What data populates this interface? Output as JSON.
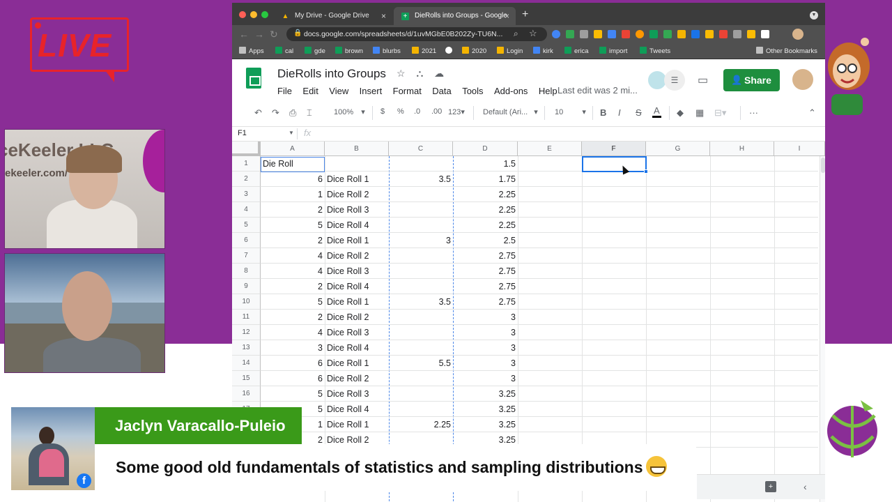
{
  "overlay": {
    "live_label": "LIVE",
    "presenter_name": "Jaclyn Varacallo-Puleio",
    "message": "Some good old fundamentals of statistics and sampling distributions",
    "cam1_sign": "ceKeeler LLC",
    "cam1_sign2": "ekeeler.com/",
    "social_icon": "facebook-icon"
  },
  "browser": {
    "tabs": [
      {
        "title": "My Drive - Google Drive",
        "icon": "google-drive-icon"
      },
      {
        "title": "DieRolls into Groups - Google",
        "icon": "google-sheets-icon"
      }
    ],
    "url": "docs.google.com/spreadsheets/d/1uvMGbE0B202Zy-TU6N...",
    "bookmarks": [
      "Apps",
      "cal",
      "gde",
      "brown",
      "blurbs",
      "2021",
      "2020",
      "Login",
      "kirk",
      "erica",
      "import",
      "Tweets"
    ],
    "other_bookmarks": "Other Bookmarks"
  },
  "sheet": {
    "title": "DieRolls into Groups",
    "menu": [
      "File",
      "Edit",
      "View",
      "Insert",
      "Format",
      "Data",
      "Tools",
      "Add-ons",
      "Help"
    ],
    "last_edit": "Last edit was 2 mi...",
    "share_label": "Share",
    "toolbar": {
      "zoom": "100%",
      "currency": "$",
      "percent": "%",
      "dec_decrease": ".0",
      "dec_increase": ".00",
      "more_formats": "123",
      "font": "Default (Ari...",
      "font_size": "10",
      "bold": "B",
      "italic": "I",
      "strike": "S",
      "text_color": "A"
    },
    "name_box": "F1",
    "fx_label": "fx",
    "columns": [
      "A",
      "B",
      "C",
      "D",
      "E",
      "F",
      "G",
      "H",
      "I"
    ],
    "selected_column": "F",
    "rows": [
      {
        "n": "1",
        "a": "Die Roll",
        "b": "",
        "c": "",
        "d": "1.5"
      },
      {
        "n": "2",
        "a": "6",
        "b": "Dice Roll 1",
        "c": "3.5",
        "d": "1.75"
      },
      {
        "n": "3",
        "a": "1",
        "b": "Dice Roll 2",
        "c": "",
        "d": "2.25"
      },
      {
        "n": "4",
        "a": "2",
        "b": "Dice Roll 3",
        "c": "",
        "d": "2.25"
      },
      {
        "n": "5",
        "a": "5",
        "b": "Dice Roll 4",
        "c": "",
        "d": "2.25"
      },
      {
        "n": "6",
        "a": "2",
        "b": "Dice Roll 1",
        "c": "3",
        "d": "2.5"
      },
      {
        "n": "7",
        "a": "4",
        "b": "Dice Roll 2",
        "c": "",
        "d": "2.75"
      },
      {
        "n": "8",
        "a": "4",
        "b": "Dice Roll 3",
        "c": "",
        "d": "2.75"
      },
      {
        "n": "9",
        "a": "2",
        "b": "Dice Roll 4",
        "c": "",
        "d": "2.75"
      },
      {
        "n": "10",
        "a": "5",
        "b": "Dice Roll 1",
        "c": "3.5",
        "d": "2.75"
      },
      {
        "n": "11",
        "a": "2",
        "b": "Dice Roll 2",
        "c": "",
        "d": "3"
      },
      {
        "n": "12",
        "a": "4",
        "b": "Dice Roll 3",
        "c": "",
        "d": "3"
      },
      {
        "n": "13",
        "a": "3",
        "b": "Dice Roll 4",
        "c": "",
        "d": "3"
      },
      {
        "n": "14",
        "a": "6",
        "b": "Dice Roll 1",
        "c": "5.5",
        "d": "3"
      },
      {
        "n": "15",
        "a": "6",
        "b": "Dice Roll 2",
        "c": "",
        "d": "3"
      },
      {
        "n": "16",
        "a": "5",
        "b": "Dice Roll 3",
        "c": "",
        "d": "3.25"
      },
      {
        "n": "17",
        "a": "5",
        "b": "Dice Roll 4",
        "c": "",
        "d": "3.25"
      },
      {
        "n": "18",
        "a": "1",
        "b": "Dice Roll 1",
        "c": "2.25",
        "d": "3.25"
      },
      {
        "n": "19",
        "a": "2",
        "b": "Dice Roll 2",
        "c": "",
        "d": "3.25"
      }
    ]
  },
  "colors": {
    "stream_purple": "#8a2d96",
    "live_red": "#e8232a",
    "share_green": "#1e8e3e",
    "name_plate_green": "#3a9a19",
    "selection_blue": "#1a73e8"
  }
}
